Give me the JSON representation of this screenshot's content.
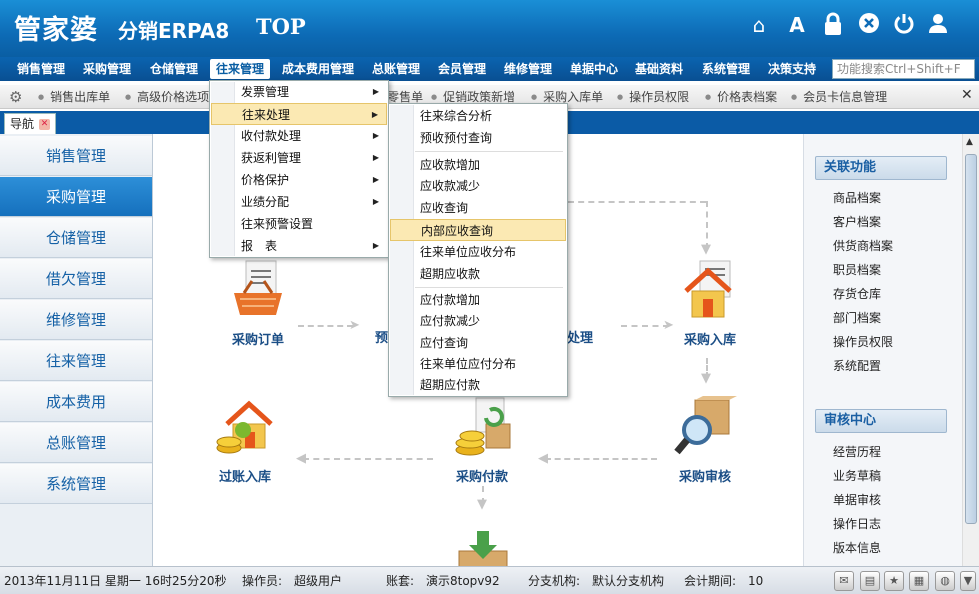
{
  "logo": {
    "brand": "管家婆",
    "product": "分销ERPA8",
    "edition": "TOP"
  },
  "top_icons": [
    "home-icon",
    "font-icon",
    "lock-icon",
    "close-circle-icon",
    "power-icon",
    "user-icon"
  ],
  "menubar": {
    "items": [
      "销售管理",
      "采购管理",
      "仓储管理",
      "往来管理",
      "成本费用管理",
      "总账管理",
      "会员管理",
      "维修管理",
      "单据中心",
      "基础资料",
      "系统管理",
      "决策支持"
    ],
    "active": "往来管理",
    "search_placeholder": "功能搜索Ctrl+Shift+F"
  },
  "quickbar": {
    "items": [
      "销售出库单",
      "高级价格选项",
      "零售单",
      "促销政策新增",
      "采购入库单",
      "操作员权限",
      "价格表档案",
      "会员卡信息管理"
    ]
  },
  "tab": {
    "label": "导航"
  },
  "sidebar": {
    "items": [
      "销售管理",
      "采购管理",
      "仓储管理",
      "借欠管理",
      "维修管理",
      "往来管理",
      "成本费用",
      "总账管理",
      "系统管理"
    ],
    "active": "采购管理"
  },
  "flow": {
    "nodes": [
      "采购订单",
      "预",
      "处理",
      "采购入库",
      "过账入库",
      "采购付款",
      "采购审核"
    ]
  },
  "menu_level1": {
    "items": [
      "发票管理",
      "往来处理",
      "收付款处理",
      "获返利管理",
      "价格保护",
      "业绩分配",
      "往来预警设置",
      "报　表"
    ],
    "highlighted": "往来处理"
  },
  "menu_level2": {
    "items": [
      "往来综合分析",
      "预收预付查询",
      "应收款增加",
      "应收款减少",
      "应收查询",
      "内部应收查询",
      "往来单位应收分布",
      "超期应收款",
      "应付款增加",
      "应付款减少",
      "应付查询",
      "往来单位应付分布",
      "超期应付款"
    ],
    "highlighted": "内部应收查询"
  },
  "right_panel": {
    "sections": [
      {
        "title": "关联功能",
        "links": [
          "商品档案",
          "客户档案",
          "供货商档案",
          "职员档案",
          "存货仓库",
          "部门档案",
          "操作员权限",
          "系统配置"
        ]
      },
      {
        "title": "审核中心",
        "links": [
          "经营历程",
          "业务草稿",
          "单据审核",
          "操作日志",
          "版本信息"
        ]
      }
    ]
  },
  "status": {
    "datetime": "2013年11月11日 星期一 16时25分20秒",
    "operator_label": "操作员:",
    "operator": "超级用户",
    "account_label": "账套:",
    "account": "演示8topv92",
    "branch_label": "分支机构:",
    "branch": "默认分支机构",
    "period_label": "会计期间:",
    "period": "10"
  }
}
